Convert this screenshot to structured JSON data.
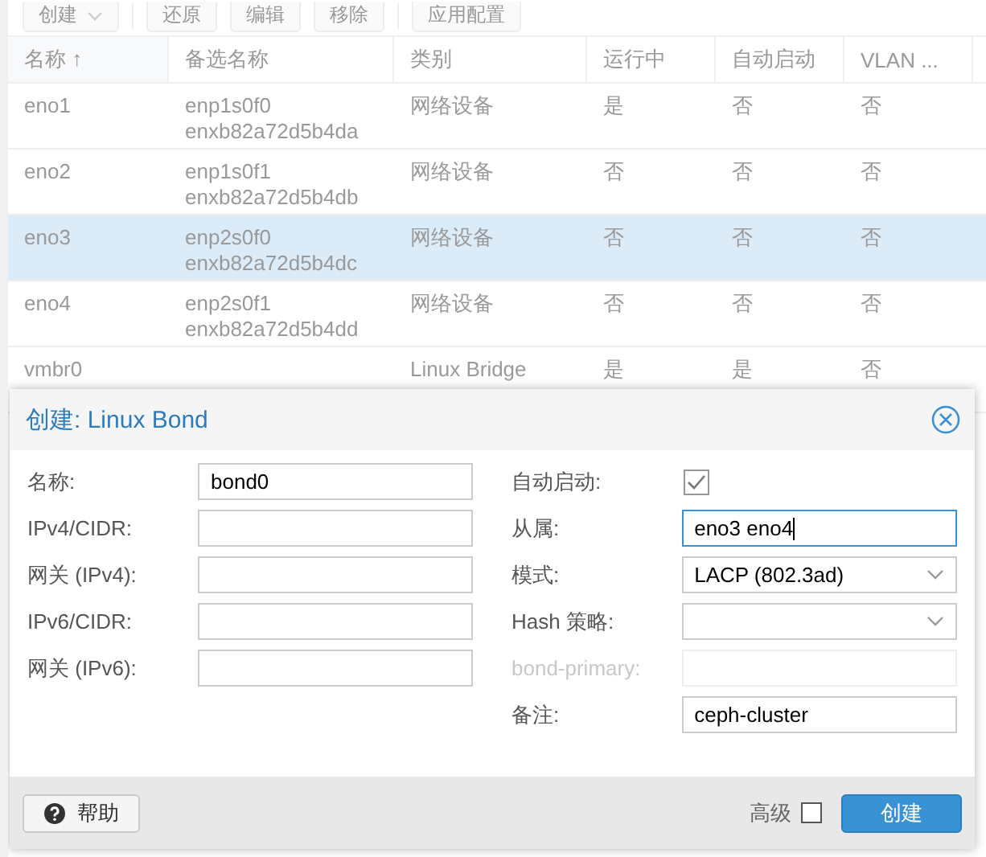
{
  "toolbar": [
    {
      "label": "创建",
      "kind": "menu"
    },
    {
      "label": "还原",
      "kind": "button"
    },
    {
      "label": "编辑",
      "kind": "button"
    },
    {
      "label": "移除",
      "kind": "button"
    },
    {
      "label": "应用配置",
      "kind": "button"
    }
  ],
  "table": {
    "columns": [
      "名称 ↑",
      "备选名称",
      "类别",
      "运行中",
      "自动启动",
      "VLAN ..."
    ],
    "rows": [
      {
        "selected": false,
        "cells": [
          "eno1",
          [
            "enp1s0f0",
            "enxb82a72d5b4da"
          ],
          "网络设备",
          "是",
          "否",
          "否"
        ]
      },
      {
        "selected": false,
        "cells": [
          "eno2",
          [
            "enp1s0f1",
            "enxb82a72d5b4db"
          ],
          "网络设备",
          "否",
          "否",
          "否"
        ]
      },
      {
        "selected": true,
        "cells": [
          "eno3",
          [
            "enp2s0f0",
            "enxb82a72d5b4dc"
          ],
          "网络设备",
          "否",
          "否",
          "否"
        ]
      },
      {
        "selected": false,
        "cells": [
          "eno4",
          [
            "enp2s0f1",
            "enxb82a72d5b4dd"
          ],
          "网络设备",
          "否",
          "否",
          "否"
        ]
      },
      {
        "selected": false,
        "cells": [
          "vmbr0",
          [],
          "Linux Bridge",
          "是",
          "是",
          "否"
        ]
      }
    ]
  },
  "dialog": {
    "title": "创建: Linux Bond",
    "left_fields": [
      {
        "label": "名称:",
        "kind": "text",
        "value": "bond0"
      },
      {
        "label": "IPv4/CIDR:",
        "kind": "text"
      },
      {
        "label": "网关 (IPv4):",
        "kind": "text"
      },
      {
        "label": "IPv6/CIDR:",
        "kind": "text"
      },
      {
        "label": "网关 (IPv6):",
        "kind": "text"
      }
    ],
    "right_fields": [
      {
        "label": "自动启动:",
        "kind": "checkbox",
        "checked": true
      },
      {
        "label": "从属:",
        "kind": "text",
        "value": "eno3 eno4",
        "focused": true
      },
      {
        "label": "模式:",
        "kind": "select",
        "value": "LACP (802.3ad)"
      },
      {
        "label": "Hash 策略:",
        "kind": "select"
      },
      {
        "label": "bond-primary:",
        "kind": "text",
        "disabled": true
      },
      {
        "label": "备注:",
        "kind": "text",
        "value": "ceph-cluster"
      }
    ],
    "help_button": "帮助",
    "advanced": {
      "label": "高级",
      "checked": false
    },
    "submit_button": "创建"
  }
}
